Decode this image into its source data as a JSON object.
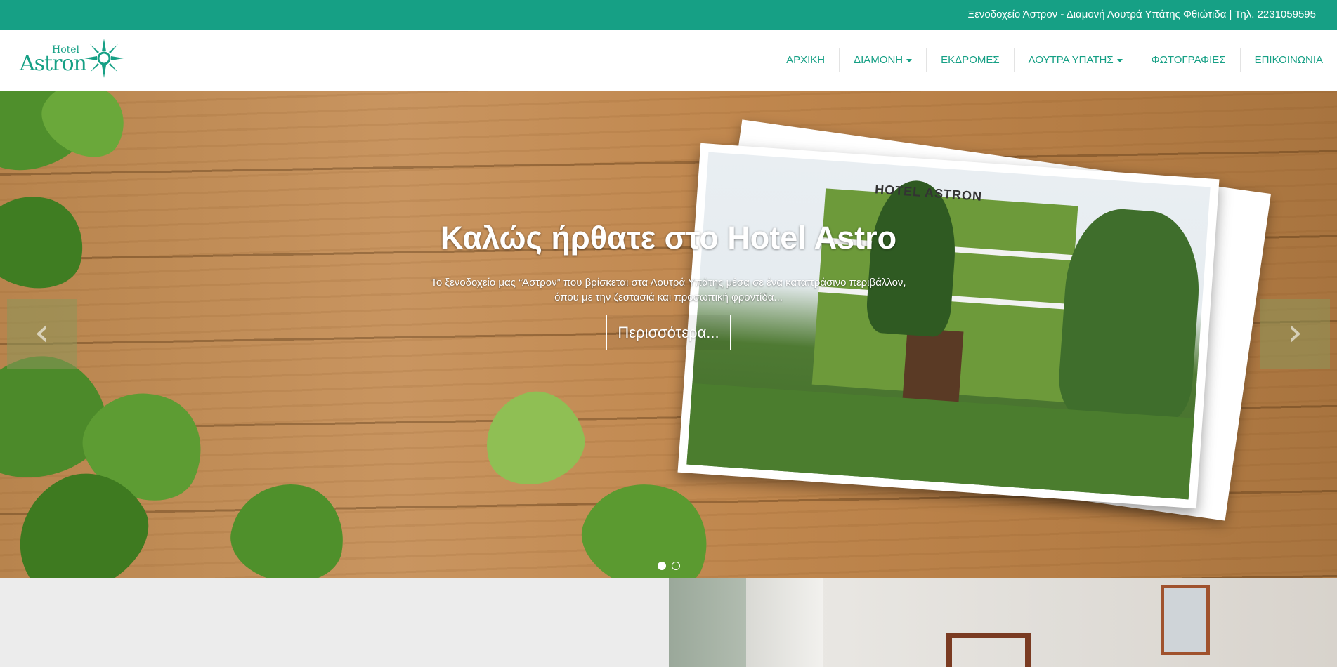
{
  "topbar": {
    "text": "Ξενοδοχείο Άστρον - Διαμονή Λουτρά Υπάτης Φθιώτιδα | Τηλ. 2231059595"
  },
  "logo": {
    "hotel": "Hotel",
    "name": "Astron"
  },
  "nav": {
    "items": [
      {
        "label": "ΑΡΧΙΚΗ"
      },
      {
        "label": "ΔΙΑΜΟΝΗ"
      },
      {
        "label": "ΕΚΔΡΟΜΕΣ"
      },
      {
        "label": "ΛΟΥΤΡΑ ΥΠΑΤΗΣ"
      },
      {
        "label": "ΦΩΤΟΓΡΑΦΙΕΣ"
      },
      {
        "label": "ΕΠΙΚΟΙΝΩΝΙΑ"
      }
    ]
  },
  "hero": {
    "title": "Καλώς ήρθατε στο Hotel Astro",
    "subtitle_line1": "Το ξενοδοχείο μας “Άστρον” που βρίσκεται στα Λουτρά Υπάτης μέσα σε ένα καταπράσινο περιβάλλον,",
    "subtitle_line2": "όπου με την ζεστασιά και προσωπική φροντίδα...",
    "button": "Περισσότερα...",
    "photo_sign": "HOTEL ASTRON",
    "prev_arrow": "‹",
    "next_arrow": "›",
    "slides_count": 2,
    "active_slide": 1
  },
  "colors": {
    "brand": "#16a085"
  },
  "icons": {
    "logo": "sun-star-icon",
    "caret": "caret-down-icon",
    "prev": "chevron-left-icon",
    "next": "chevron-right-icon"
  }
}
